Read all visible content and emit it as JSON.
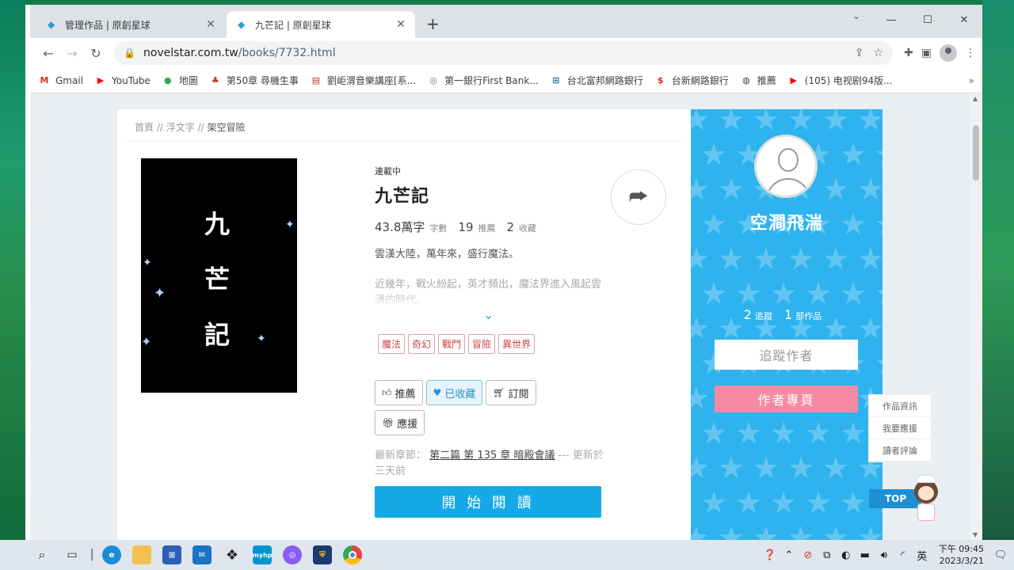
{
  "browser": {
    "tabs": [
      {
        "title": "管理作品 | 原創星球",
        "active": false
      },
      {
        "title": "九芒記 | 原創星球",
        "active": true
      }
    ],
    "url_host": "novelstar.com.tw",
    "url_path": "/books/7732.html",
    "bookmarks": [
      {
        "label": "Gmail",
        "icon": "gmail-icon",
        "icon_text": "M",
        "color": "#d93025"
      },
      {
        "label": "YouTube",
        "icon": "youtube-icon",
        "icon_text": "▶",
        "color": "#ff0000"
      },
      {
        "label": "地圖",
        "icon": "maps-icon",
        "icon_text": "●",
        "color": "#34a853"
      },
      {
        "label": "第50章 尋機生事",
        "icon": "book-site-icon",
        "icon_text": "♣",
        "color": "#c0392b"
      },
      {
        "label": "劉岠渭音樂講座[系...",
        "icon": "music-site-icon",
        "icon_text": "▤",
        "color": "#c0392b"
      },
      {
        "label": "第一銀行First Bank...",
        "icon": "firstbank-icon",
        "icon_text": "◎",
        "color": "#777777"
      },
      {
        "label": "台北富邦網路銀行",
        "icon": "fubon-icon",
        "icon_text": "⊞",
        "color": "#1f7a8c"
      },
      {
        "label": "台新網路銀行",
        "icon": "taishin-icon",
        "icon_text": "$",
        "color": "#d32f2f"
      },
      {
        "label": "推薦",
        "icon": "globe-icon",
        "icon_text": "◍",
        "color": "#444444"
      },
      {
        "label": "(105) 电视剧94版...",
        "icon": "youtube-icon",
        "icon_text": "▶",
        "color": "#ff0000"
      }
    ]
  },
  "page": {
    "breadcrumb": [
      "首頁",
      "浮文字",
      "架空冒險"
    ],
    "breadcrumb_sep": " // ",
    "cover_chars": [
      "九",
      "芒",
      "記"
    ],
    "status": "連載中",
    "title": "九芒記",
    "stats": {
      "words_value": "43.8萬字",
      "words_label": "字數",
      "recommend_value": "19",
      "recommend_label": "推薦",
      "collect_value": "2",
      "collect_label": "收藏"
    },
    "desc_line1": "雲漢大陸，萬年來，盛行魔法。",
    "desc_line2": "近幾年，戰火紛起，英才頻出，魔法界進入風起雲湧的時代。",
    "expand_icon": "chevron-down-icon",
    "tags": [
      "魔法",
      "奇幻",
      "戰鬥",
      "冒險",
      "異世界"
    ],
    "buttons": {
      "recommend": "推薦",
      "collected": "已收藏",
      "subscribe": "訂閱",
      "support": "應援"
    },
    "latest_prefix": "最新章節：",
    "latest_link": "第二篇 第 135 章 暗殿會議",
    "latest_suffix": " --- 更新於三天前",
    "read_button": "開 始 閱 讀"
  },
  "author": {
    "name": "空澗飛湍",
    "followers_value": "2",
    "followers_label": "追蹤",
    "works_value": "1",
    "works_label": "部作品",
    "follow_button": "追蹤作者",
    "page_button": "作者專頁"
  },
  "side_menu": [
    "作品資訊",
    "我要應援",
    "讀者評論"
  ],
  "top_button": "TOP",
  "taskbar": {
    "time": "下午 09:45",
    "date": "2023/3/21",
    "ime": "英"
  },
  "colors": {
    "accent": "#14a9e6",
    "author_bg": "#2fb3ee",
    "author_page": "#f78aa3",
    "tag": "#cc4444"
  }
}
